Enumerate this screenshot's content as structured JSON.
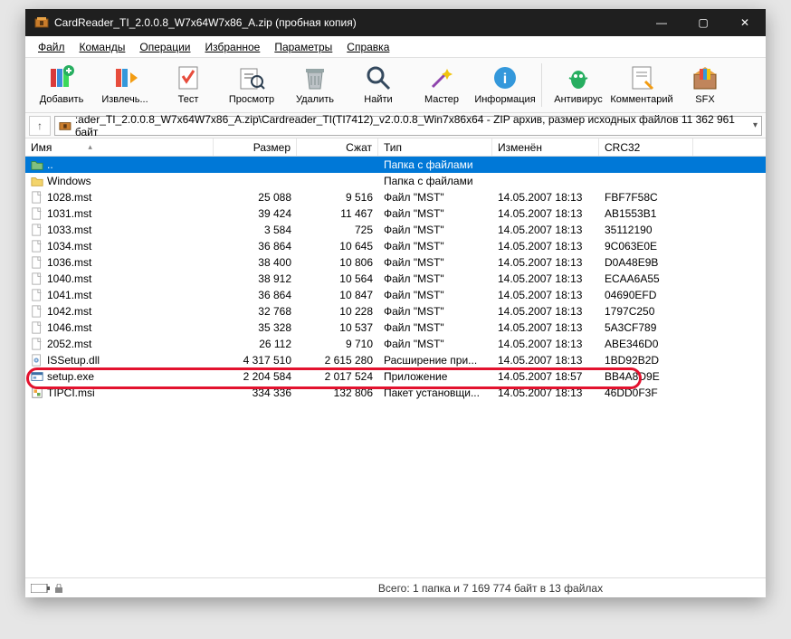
{
  "title": "CardReader_TI_2.0.0.8_W7x64W7x86_A.zip (пробная копия)",
  "menu": [
    "Файл",
    "Команды",
    "Операции",
    "Избранное",
    "Параметры",
    "Справка"
  ],
  "toolbar": {
    "add": "Добавить",
    "extract": "Извлечь...",
    "test": "Тест",
    "view": "Просмотр",
    "delete": "Удалить",
    "find": "Найти",
    "wizard": "Мастер",
    "info": "Информация",
    "virus": "Антивирус",
    "comment": "Комментарий",
    "sfx": "SFX"
  },
  "path": ":ader_TI_2.0.0.8_W7x64W7x86_A.zip\\Cardreader_TI(TI7412)_v2.0.0.8_Win7x86x64 - ZIP архив, размер исходных файлов 11 362 961 байт",
  "columns": {
    "name": "Имя",
    "size": "Размер",
    "packed": "Сжат",
    "type": "Тип",
    "modified": "Изменён",
    "crc": "CRC32"
  },
  "parent_type": "Папка с файлами",
  "rows": [
    {
      "icon": "folder",
      "name": "Windows",
      "size": "",
      "packed": "",
      "type": "Папка с файлами",
      "mod": "",
      "crc": ""
    },
    {
      "icon": "file",
      "name": "1028.mst",
      "size": "25 088",
      "packed": "9 516",
      "type": "Файл \"MST\"",
      "mod": "14.05.2007 18:13",
      "crc": "FBF7F58C"
    },
    {
      "icon": "file",
      "name": "1031.mst",
      "size": "39 424",
      "packed": "11 467",
      "type": "Файл \"MST\"",
      "mod": "14.05.2007 18:13",
      "crc": "AB1553B1"
    },
    {
      "icon": "file",
      "name": "1033.mst",
      "size": "3 584",
      "packed": "725",
      "type": "Файл \"MST\"",
      "mod": "14.05.2007 18:13",
      "crc": "35112190"
    },
    {
      "icon": "file",
      "name": "1034.mst",
      "size": "36 864",
      "packed": "10 645",
      "type": "Файл \"MST\"",
      "mod": "14.05.2007 18:13",
      "crc": "9C063E0E"
    },
    {
      "icon": "file",
      "name": "1036.mst",
      "size": "38 400",
      "packed": "10 806",
      "type": "Файл \"MST\"",
      "mod": "14.05.2007 18:13",
      "crc": "D0A48E9B"
    },
    {
      "icon": "file",
      "name": "1040.mst",
      "size": "38 912",
      "packed": "10 564",
      "type": "Файл \"MST\"",
      "mod": "14.05.2007 18:13",
      "crc": "ECAA6A55"
    },
    {
      "icon": "file",
      "name": "1041.mst",
      "size": "36 864",
      "packed": "10 847",
      "type": "Файл \"MST\"",
      "mod": "14.05.2007 18:13",
      "crc": "04690EFD"
    },
    {
      "icon": "file",
      "name": "1042.mst",
      "size": "32 768",
      "packed": "10 228",
      "type": "Файл \"MST\"",
      "mod": "14.05.2007 18:13",
      "crc": "1797C250"
    },
    {
      "icon": "file",
      "name": "1046.mst",
      "size": "35 328",
      "packed": "10 537",
      "type": "Файл \"MST\"",
      "mod": "14.05.2007 18:13",
      "crc": "5A3CF789"
    },
    {
      "icon": "file",
      "name": "2052.mst",
      "size": "26 112",
      "packed": "9 710",
      "type": "Файл \"MST\"",
      "mod": "14.05.2007 18:13",
      "crc": "ABE346D0"
    },
    {
      "icon": "dll",
      "name": "ISSetup.dll",
      "size": "4 317 510",
      "packed": "2 615 280",
      "type": "Расширение при...",
      "mod": "14.05.2007 18:13",
      "crc": "1BD92B2D"
    },
    {
      "icon": "exe",
      "name": "setup.exe",
      "size": "2 204 584",
      "packed": "2 017 524",
      "type": "Приложение",
      "mod": "14.05.2007 18:57",
      "crc": "BB4A8D9E"
    },
    {
      "icon": "msi",
      "name": "TIPCI.msi",
      "size": "334 336",
      "packed": "132 806",
      "type": "Пакет установщи...",
      "mod": "14.05.2007 18:13",
      "crc": "46DD0F3F"
    }
  ],
  "status": "Всего: 1 папка и 7 169 774 байт в 13 файлах"
}
